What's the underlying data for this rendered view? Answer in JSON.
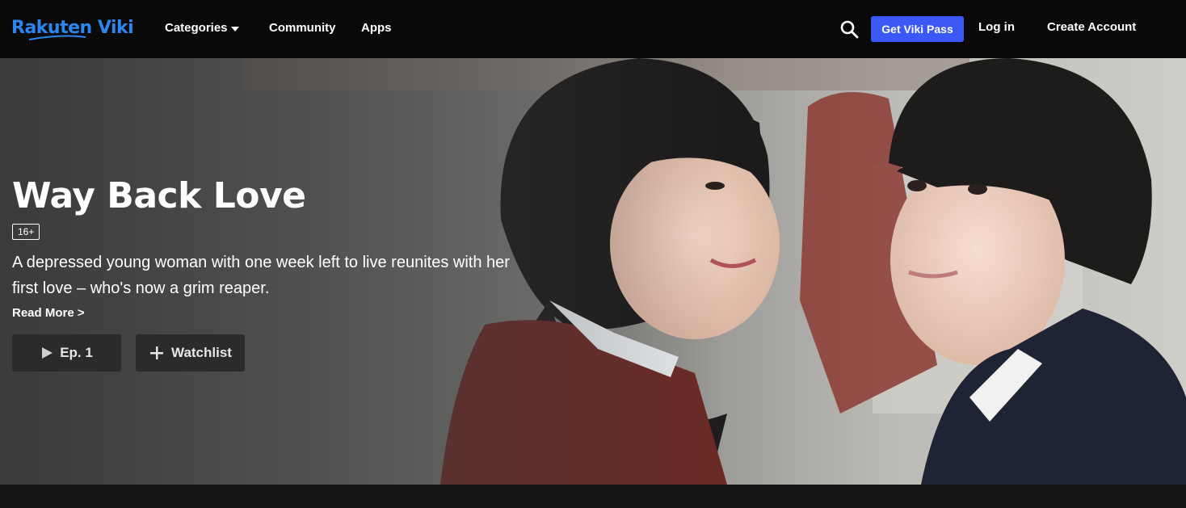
{
  "header": {
    "logo_text": "Rakuten Viki",
    "nav": {
      "categories": "Categories",
      "community": "Community",
      "apps": "Apps"
    },
    "get_pass": "Get Viki Pass",
    "login": "Log in",
    "create_account": "Create Account"
  },
  "hero": {
    "title": "Way Back Love",
    "rating": "16+",
    "synopsis": "A depressed young woman with one week left to live reunites with her first love – who's now a grim reaper.",
    "read_more": "Read More >",
    "play_label": "Ep. 1",
    "watchlist_label": "Watchlist"
  },
  "colors": {
    "brand": "#2d86f0",
    "pass_button": "#3b59f7",
    "header_bg": "#0a0a0a"
  }
}
